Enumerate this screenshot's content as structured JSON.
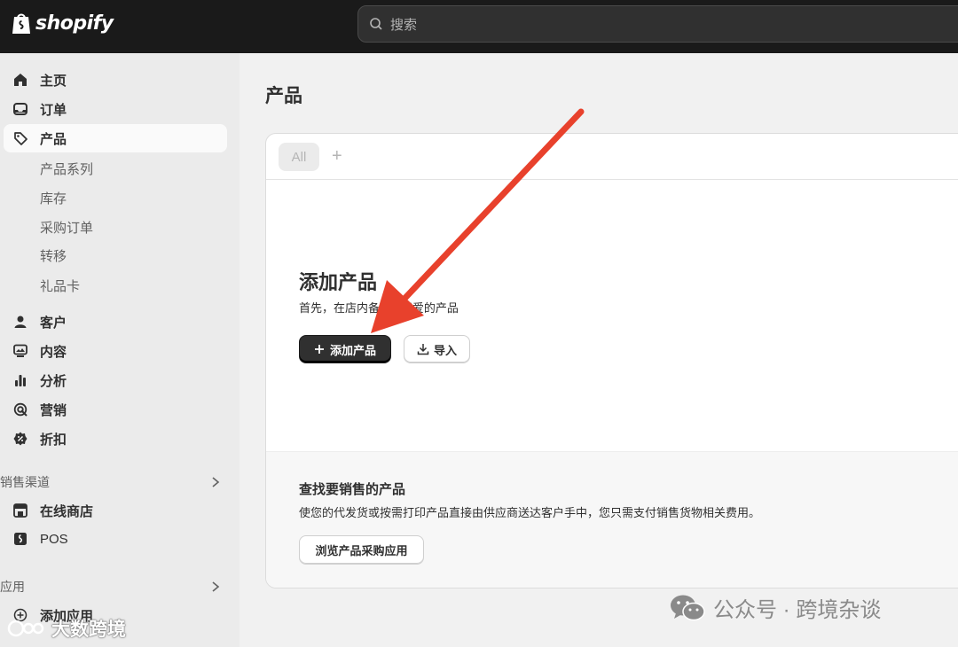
{
  "topbar": {
    "brand": "shopify",
    "search_placeholder": "搜索"
  },
  "sidebar": {
    "items": [
      {
        "label": "主页",
        "icon": "home-icon"
      },
      {
        "label": "订单",
        "icon": "inbox-icon"
      },
      {
        "label": "产品",
        "icon": "tag-icon",
        "active": true
      }
    ],
    "product_subitems": [
      "产品系列",
      "库存",
      "采购订单",
      "转移",
      "礼品卡"
    ],
    "items2": [
      {
        "label": "客户",
        "icon": "person-icon"
      },
      {
        "label": "内容",
        "icon": "content-icon"
      },
      {
        "label": "分析",
        "icon": "bar-chart-icon"
      },
      {
        "label": "营销",
        "icon": "target-icon"
      },
      {
        "label": "折扣",
        "icon": "discount-icon"
      }
    ],
    "sales_channels_header": "销售渠道",
    "channels": [
      {
        "label": "在线商店",
        "icon": "store-icon"
      },
      {
        "label": "POS",
        "icon": "pos-icon"
      }
    ],
    "apps_header": "应用",
    "add_app_label": "添加应用"
  },
  "main": {
    "page_title": "产品",
    "tabs": {
      "all_label": "All",
      "add_label": "+"
    },
    "empty_state": {
      "title": "添加产品",
      "description": "首先，在店内备...客喜爱的产品",
      "add_button": "添加产品",
      "import_button": "导入"
    },
    "find_section": {
      "title": "查找要销售的产品",
      "description": "使您的代发货或按需打印产品直接由供应商送达客户手中，您只需支付销售货物相关费用。",
      "browse_button": "浏览产品采购应用"
    }
  },
  "watermarks": {
    "right": "公众号 · 跨境杂谈",
    "left": "大数跨境"
  },
  "colors": {
    "topbar": "#1a1a1a",
    "sidebar": "#ebebeb",
    "primary_button": "#303030",
    "annotation_arrow": "#e8412c"
  }
}
